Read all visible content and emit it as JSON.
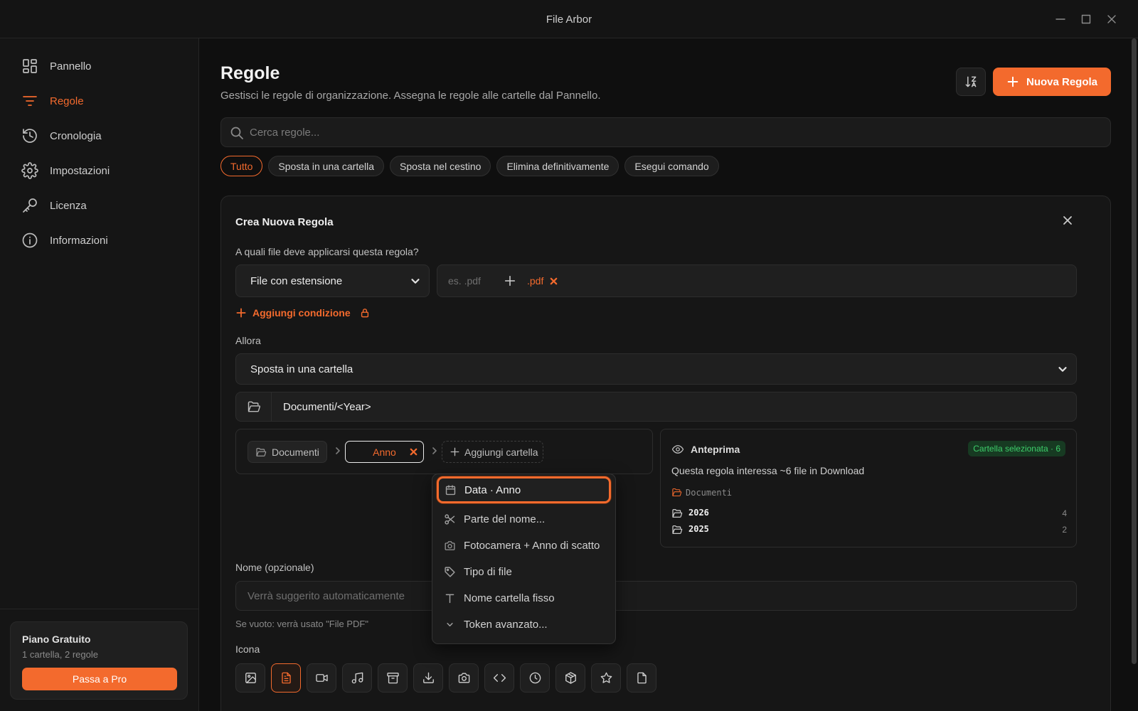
{
  "window": {
    "title": "File Arbor"
  },
  "sidebar": {
    "items": [
      {
        "label": "Pannello",
        "icon": "dashboard-icon"
      },
      {
        "label": "Regole",
        "icon": "filter-icon",
        "active": true
      },
      {
        "label": "Cronologia",
        "icon": "history-icon"
      },
      {
        "label": "Impostazioni",
        "icon": "gear-icon"
      },
      {
        "label": "Licenza",
        "icon": "key-icon"
      },
      {
        "label": "Informazioni",
        "icon": "info-icon"
      }
    ],
    "plan": {
      "title": "Piano Gratuito",
      "subtitle": "1 cartella, 2 regole",
      "button": "Passa a Pro"
    }
  },
  "header": {
    "title": "Regole",
    "subtitle": "Gestisci le regole di organizzazione. Assegna le regole alle cartelle dal Pannello.",
    "new_rule_label": "Nuova Regola"
  },
  "search": {
    "placeholder": "Cerca regole..."
  },
  "filters": [
    "Tutto",
    "Sposta in una cartella",
    "Sposta nel cestino",
    "Elimina definitivamente",
    "Esegui comando"
  ],
  "form": {
    "title": "Crea Nuova Regola",
    "question": "A quali file deve applicarsi questa regola?",
    "condition_type": "File con estensione",
    "extension_placeholder": "es. .pdf",
    "extension_tag": ".pdf",
    "add_condition": "Aggiungi condizione",
    "then_label": "Allora",
    "action": "Sposta in una cartella",
    "path": "Documenti/<Year>",
    "segments": {
      "root": "Documenti",
      "token": "Anno",
      "add": "Aggiungi cartella"
    },
    "preview": {
      "title": "Anteprima",
      "badge": "Cartella selezionata · 6",
      "description": "Questa regola interessa ~6 file in Download",
      "root": "Documenti",
      "rows": [
        {
          "name": "2026",
          "count": "4"
        },
        {
          "name": "2025",
          "count": "2"
        }
      ]
    },
    "name_label": "Nome (opzionale)",
    "name_placeholder": "Verrà suggerito automaticamente",
    "name_hint": "Se vuoto: verrà usato \"File PDF\"",
    "icon_label": "Icona",
    "icons": [
      "image-icon",
      "document-icon",
      "video-icon",
      "music-icon",
      "archive-icon",
      "download-icon",
      "camera-icon",
      "code-icon",
      "clock-icon",
      "package-icon",
      "star-icon",
      "file-icon"
    ],
    "selected_icon": "document-icon"
  },
  "menu": {
    "items": [
      {
        "label": "Data · Anno",
        "icon": "calendar-icon",
        "highlighted": true
      },
      {
        "label": "Parte del nome...",
        "icon": "scissors-icon"
      },
      {
        "label": "Fotocamera + Anno di scatto",
        "icon": "camera-icon"
      },
      {
        "label": "Tipo di file",
        "icon": "tag-icon"
      },
      {
        "label": "Nome cartella fisso",
        "icon": "text-icon"
      },
      {
        "label": "Token avanzato...",
        "icon": "chevron-down-icon"
      }
    ]
  },
  "colors": {
    "accent": "#f36a2d",
    "background": "#0f0f0f",
    "success": "#3ecf6b"
  }
}
